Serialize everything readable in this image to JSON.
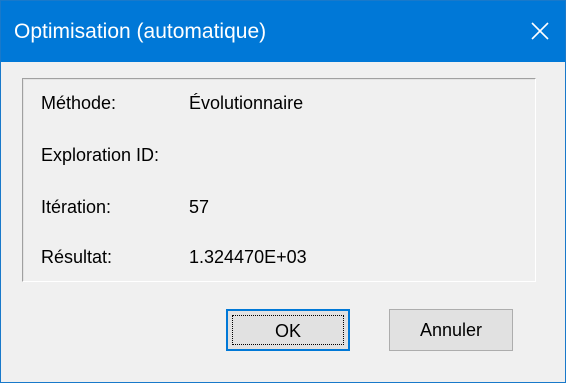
{
  "window": {
    "title": "Optimisation (automatique)",
    "close_icon": "close-icon"
  },
  "info": {
    "method_label": "Méthode:",
    "method_value": "Évolutionnaire",
    "exploration_label": "Exploration ID:",
    "exploration_value": "",
    "iteration_label": "Itération:",
    "iteration_value": "57",
    "result_label": "Résultat:",
    "result_value": "1.324470E+03"
  },
  "buttons": {
    "ok_label": "OK",
    "cancel_label": "Annuler"
  },
  "colors": {
    "titlebar": "#0078d7",
    "button_face": "#e1e1e1",
    "dialog_background": "#f0f0f0"
  }
}
